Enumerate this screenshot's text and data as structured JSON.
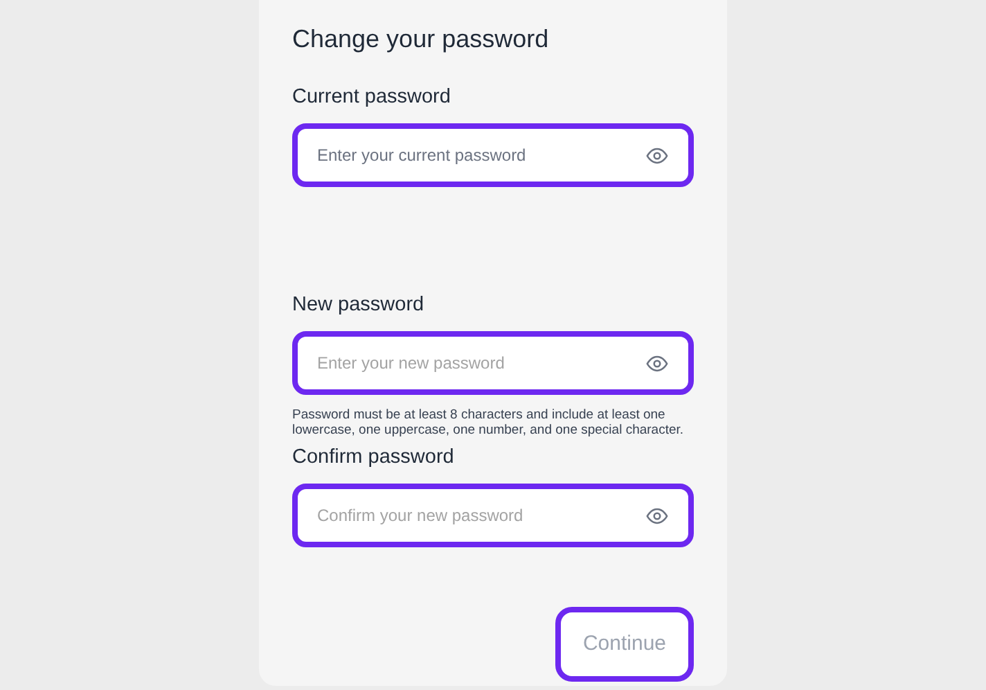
{
  "title": "Change your password",
  "fields": [
    {
      "label": "Current password",
      "placeholder": "Enter your current password",
      "highlighted": true
    },
    {
      "label": "New password",
      "placeholder": "Enter your new password",
      "highlighted": true,
      "hint": "Password must be at least 8 characters and include at least one lowercase, one uppercase, one number, and one special character."
    },
    {
      "label": "Confirm password",
      "placeholder": "Confirm your new password",
      "highlighted": true
    }
  ],
  "button": {
    "label": "Continue",
    "disabled": true,
    "highlighted": true
  }
}
